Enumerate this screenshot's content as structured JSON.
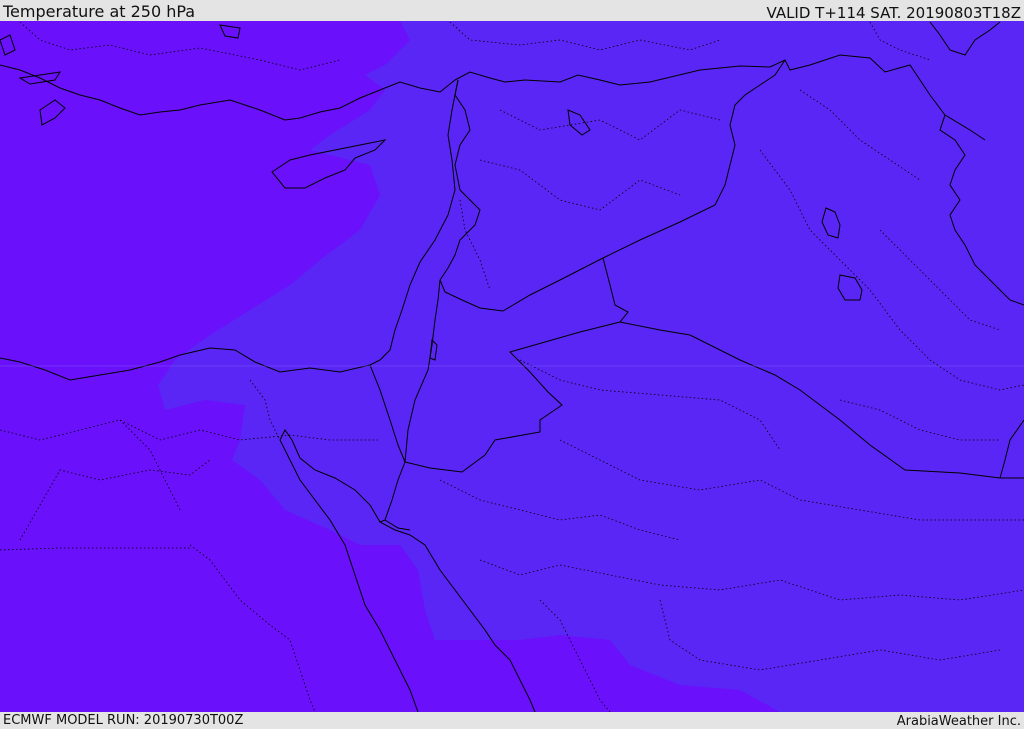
{
  "header": {
    "title": "Temperature at 250 hPa",
    "valid": "VALID T+114 SAT. 20190803T18Z"
  },
  "footer": {
    "model_run": "ECMWF MODEL RUN: 20190730T00Z",
    "credit": "ArabiaWeather Inc."
  },
  "map": {
    "colors": {
      "cold_zone": "#6a10fb",
      "warm_zone": "#5a26f5",
      "border": "#000000",
      "background": "#e4e4e4"
    }
  }
}
